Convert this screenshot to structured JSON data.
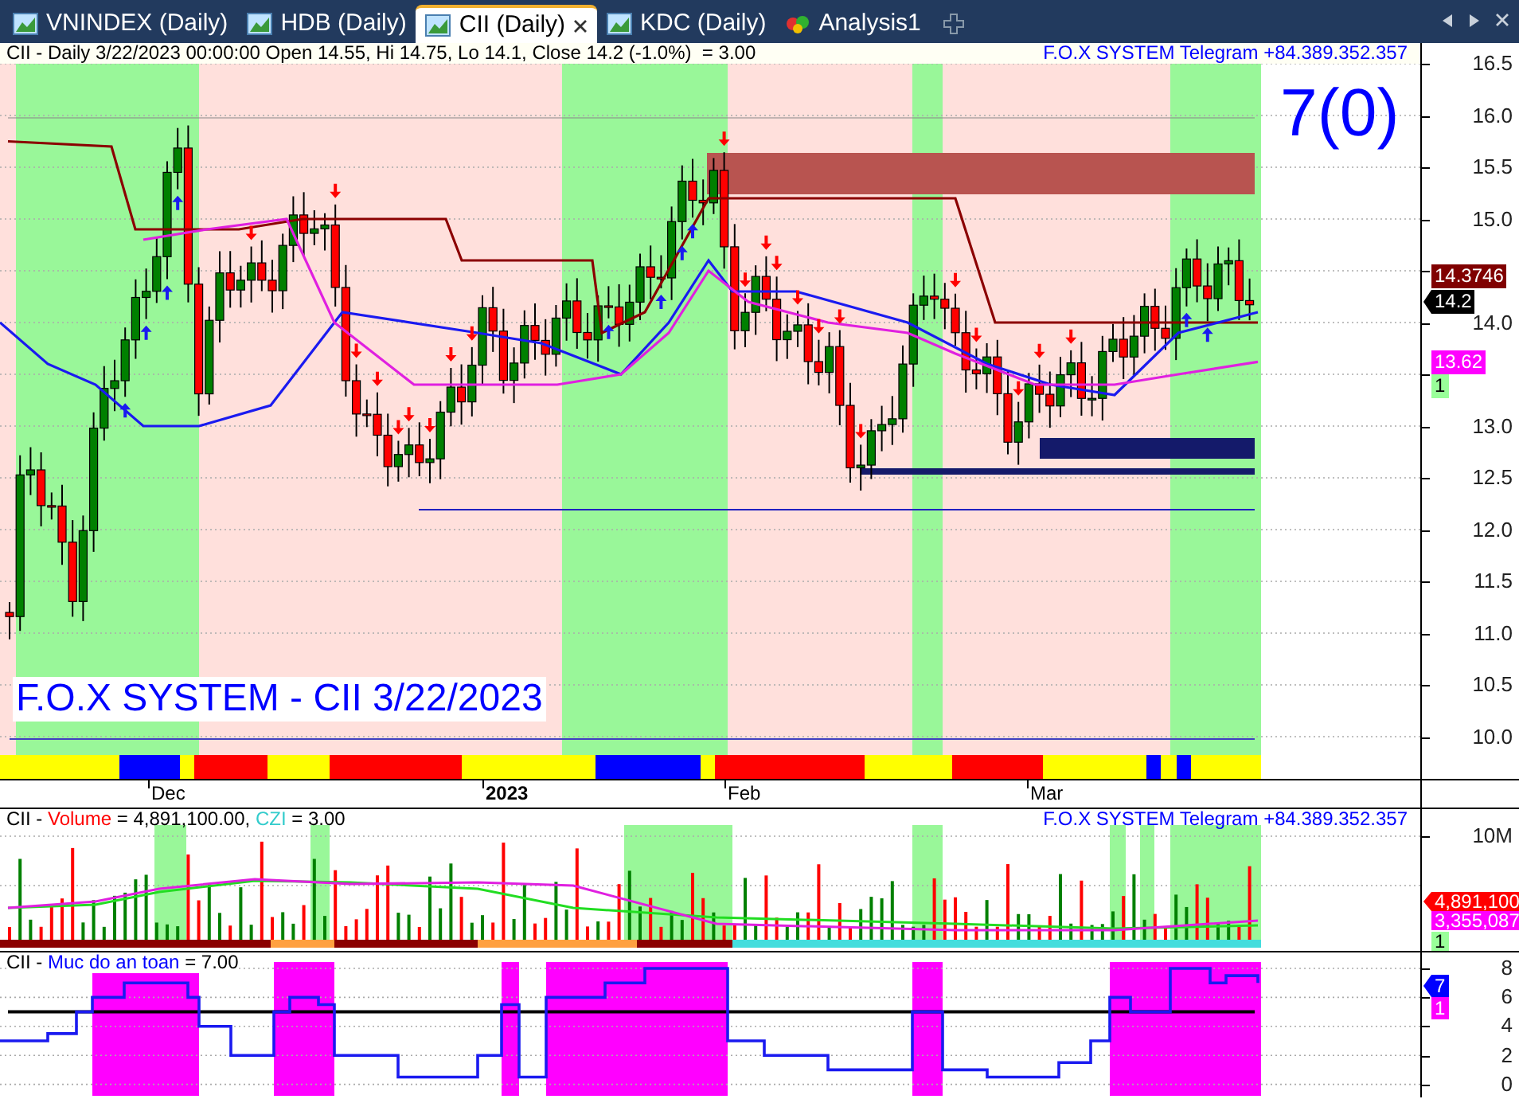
{
  "tabs": [
    {
      "label": "VNINDEX (Daily)",
      "selected": false,
      "kind": "chart"
    },
    {
      "label": "HDB (Daily)",
      "selected": false,
      "kind": "chart"
    },
    {
      "label": "CII (Daily)",
      "selected": true,
      "kind": "chart"
    },
    {
      "label": "KDC (Daily)",
      "selected": false,
      "kind": "chart"
    },
    {
      "label": "Analysis1",
      "selected": false,
      "kind": "analysis"
    }
  ],
  "price_panel": {
    "header": "CII - Daily 3/22/2023 00:00:00 Open 14.55, Hi 14.75, Lo 14.1, Close 14.2 (-1.0%)  = 3.00",
    "brand": "F.O.X SYSTEM Telegram +84.389.352.357",
    "signal": "7(0)",
    "caption": "F.O.X SYSTEM - CII 3/22/2023",
    "y_ticks": [
      "16.5",
      "16.0",
      "15.5",
      "15.0",
      "14.0",
      "13.0",
      "12.5",
      "12.0",
      "11.5",
      "11.0",
      "10.5",
      "10.0"
    ],
    "tags": [
      {
        "text": "14.3746",
        "color": "#800000",
        "pointer": false
      },
      {
        "text": "14.2",
        "color": "#000000",
        "pointer": true
      },
      {
        "text": "13.62",
        "color": "#ff00ff",
        "pointer": false
      },
      {
        "text": "1",
        "color": "#99ff99",
        "pointer": false
      }
    ]
  },
  "date_axis": [
    {
      "label": "Dec",
      "bold": false
    },
    {
      "label": "2023",
      "bold": true
    },
    {
      "label": "Feb",
      "bold": false
    },
    {
      "label": "Mar",
      "bold": false
    }
  ],
  "volume_panel": {
    "header": [
      {
        "text": "CII - ",
        "color": "#000000"
      },
      {
        "text": "Volume",
        "color": "#ff0000"
      },
      {
        "text": " = 4,891,100.00, ",
        "color": "#000000"
      },
      {
        "text": "CZI",
        "color": "#33cccc"
      },
      {
        "text": " = 3.00",
        "color": "#000000"
      }
    ],
    "brand": "F.O.X SYSTEM Telegram +84.389.352.357",
    "y_ticks": [
      "10M"
    ],
    "tags": [
      {
        "text": "4,891,100",
        "color": "#ff0000",
        "pointer": true
      },
      {
        "text": "3,355,087",
        "color": "#ff00ff",
        "pointer": false
      },
      {
        "text": "1",
        "color": "#99ff99",
        "pointer": false
      }
    ]
  },
  "safety_panel": {
    "header": [
      {
        "text": "CII - ",
        "color": "#000000"
      },
      {
        "text": "Muc do an toan",
        "color": "#0000ff"
      },
      {
        "text": " = 7.00",
        "color": "#000000"
      }
    ],
    "y_ticks": [
      "8",
      "6",
      "4",
      "2",
      "0"
    ],
    "tags": [
      {
        "text": "7",
        "color": "#0000ff",
        "pointer": true
      },
      {
        "text": "1",
        "color": "#ff00ff",
        "pointer": false
      }
    ]
  }
}
